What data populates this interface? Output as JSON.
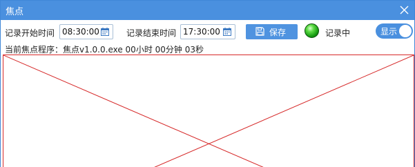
{
  "window": {
    "title": "焦点",
    "close_icon": "close-icon",
    "accent_color": "#4a90df"
  },
  "toolbar": {
    "start_label": "记录开始时间",
    "start_time": "08:30:00",
    "end_label": "记录结束时间",
    "end_time": "17:30:00",
    "calendar_icon": "calendar-icon",
    "save_label": "保存",
    "save_icon": "save-icon",
    "status_label": "记录中",
    "status_color": "#2ebd1f",
    "toggle_label": "显示",
    "toggle_on": true
  },
  "info": {
    "text": "当前焦点程序：焦点v1.0.0.exe 00小时 00分钟 03秒"
  },
  "content": {
    "placeholder_color": "#d62828"
  }
}
